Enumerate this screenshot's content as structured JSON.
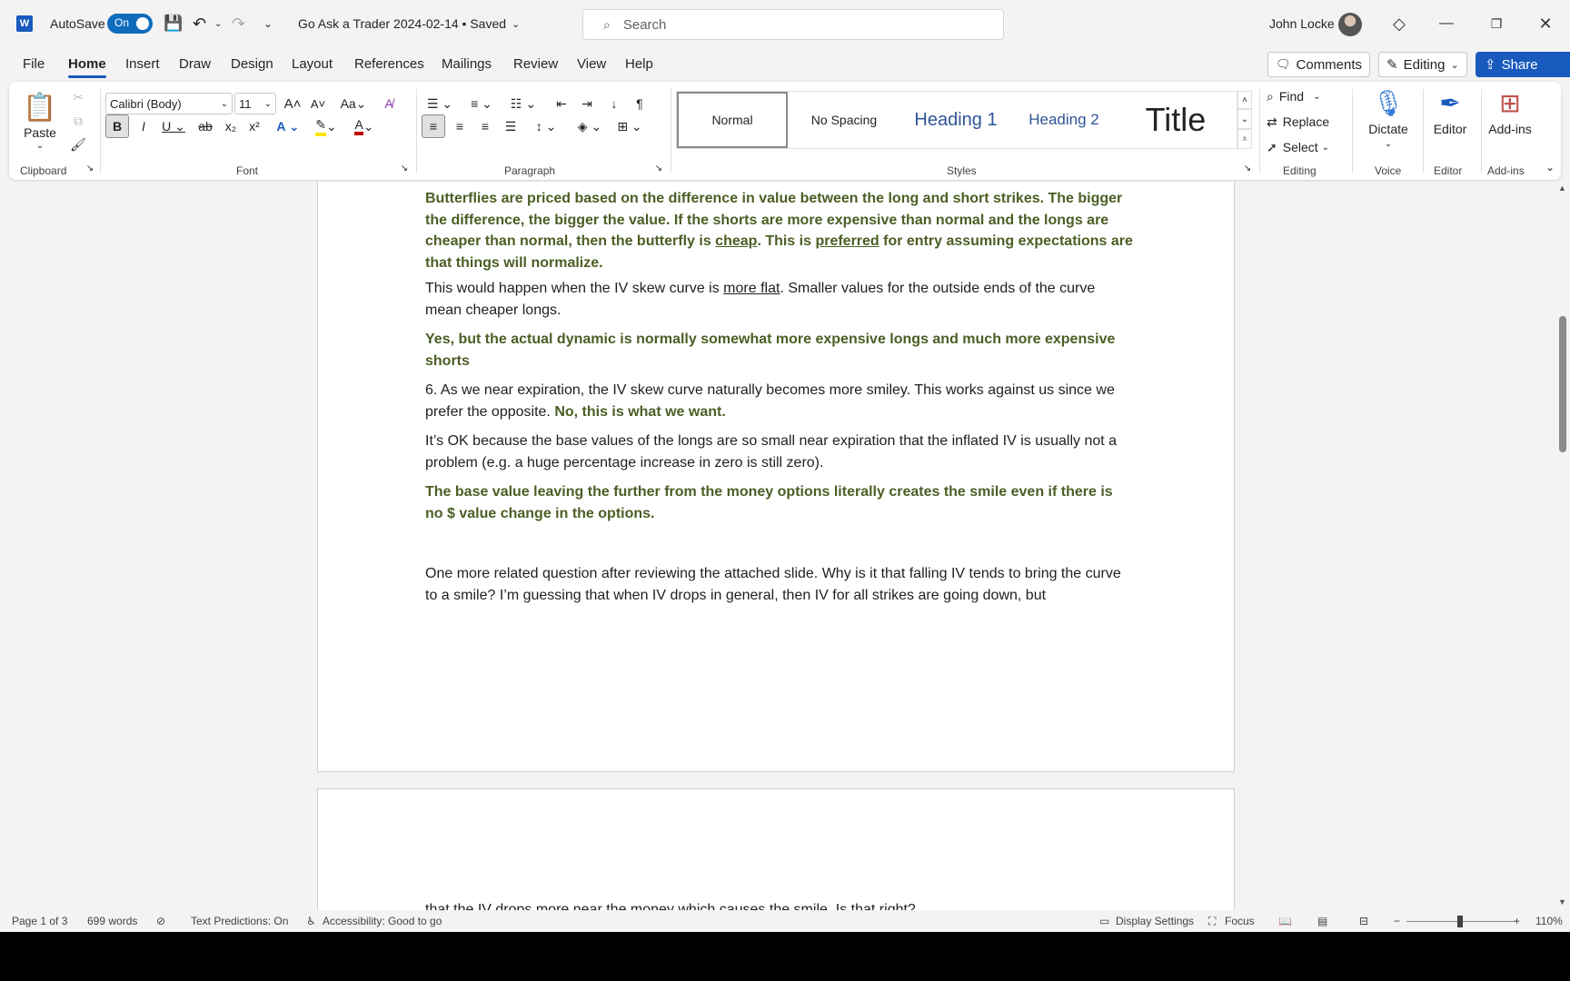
{
  "titlebar": {
    "autosave_label": "AutoSave",
    "autosave_state": "On",
    "doc_title": "Go Ask a Trader 2024-02-14 • Saved",
    "search_placeholder": "Search",
    "user_name": "John Locke"
  },
  "menu": {
    "tabs": [
      "File",
      "Home",
      "Insert",
      "Draw",
      "Design",
      "Layout",
      "References",
      "Mailings",
      "Review",
      "View",
      "Help"
    ],
    "active_tab": "Home",
    "comments": "Comments",
    "editing": "Editing",
    "share": "Share"
  },
  "ribbon": {
    "paste": "Paste",
    "font_name": "Calibri (Body)",
    "font_size": "11",
    "groups": {
      "clipboard": "Clipboard",
      "font": "Font",
      "paragraph": "Paragraph",
      "styles": "Styles",
      "editing": "Editing",
      "voice": "Voice",
      "editor": "Editor",
      "addins": "Add-ins"
    },
    "styles": [
      "Normal",
      "No Spacing",
      "Heading 1",
      "Heading 2",
      "Title"
    ],
    "find": "Find",
    "replace": "Replace",
    "select": "Select",
    "dictate": "Dictate",
    "editor_btn": "Editor",
    "addins_btn": "Add-ins",
    "accent_color": "#185abd",
    "answer_color": "#4b5e25"
  },
  "document": {
    "p1_a": "Butterflies are priced based on the difference in value between the long and short strikes. The bigger the difference, the bigger the value. If the shorts are more expensive than normal and the longs are cheaper than normal, then the butterfly is ",
    "p1_b": "cheap",
    "p1_c": ". This is ",
    "p1_d": "preferred",
    "p1_e": " for entry assuming expectations are that things will normalize.",
    "p2_a": "This would happen when the IV skew curve is ",
    "p2_b": "more flat",
    "p2_c": ". Smaller values for the outside ends of the curve mean cheaper longs.",
    "p3": "Yes, but the actual dynamic is normally somewhat more expensive longs and much more expensive shorts",
    "p4_a": "6. As we near expiration, the IV skew curve naturally becomes more smiley. This works against us since we prefer the opposite. ",
    "p4_b": "No, this is what we want.",
    "p5": "It’s OK because the base values of the longs are so small near expiration that the inflated IV is usually not a problem (e.g. a huge percentage increase in zero is still zero).",
    "p6": "The base value leaving the further from the money options literally creates the smile even if there is no $ value change in the options.",
    "p7": "One more related question after reviewing the attached slide. Why is it that falling IV tends to bring the curve to a smile? I’m guessing that when IV drops in general, then IV for all strikes are going down, but",
    "p8": "that the IV drops more near the money which causes the smile. Is that right?"
  },
  "status": {
    "page": "Page 1 of 3",
    "words": "699 words",
    "predictions": "Text Predictions: On",
    "accessibility": "Accessibility: Good to go",
    "display_settings": "Display Settings",
    "focus": "Focus",
    "zoom": "110%"
  }
}
